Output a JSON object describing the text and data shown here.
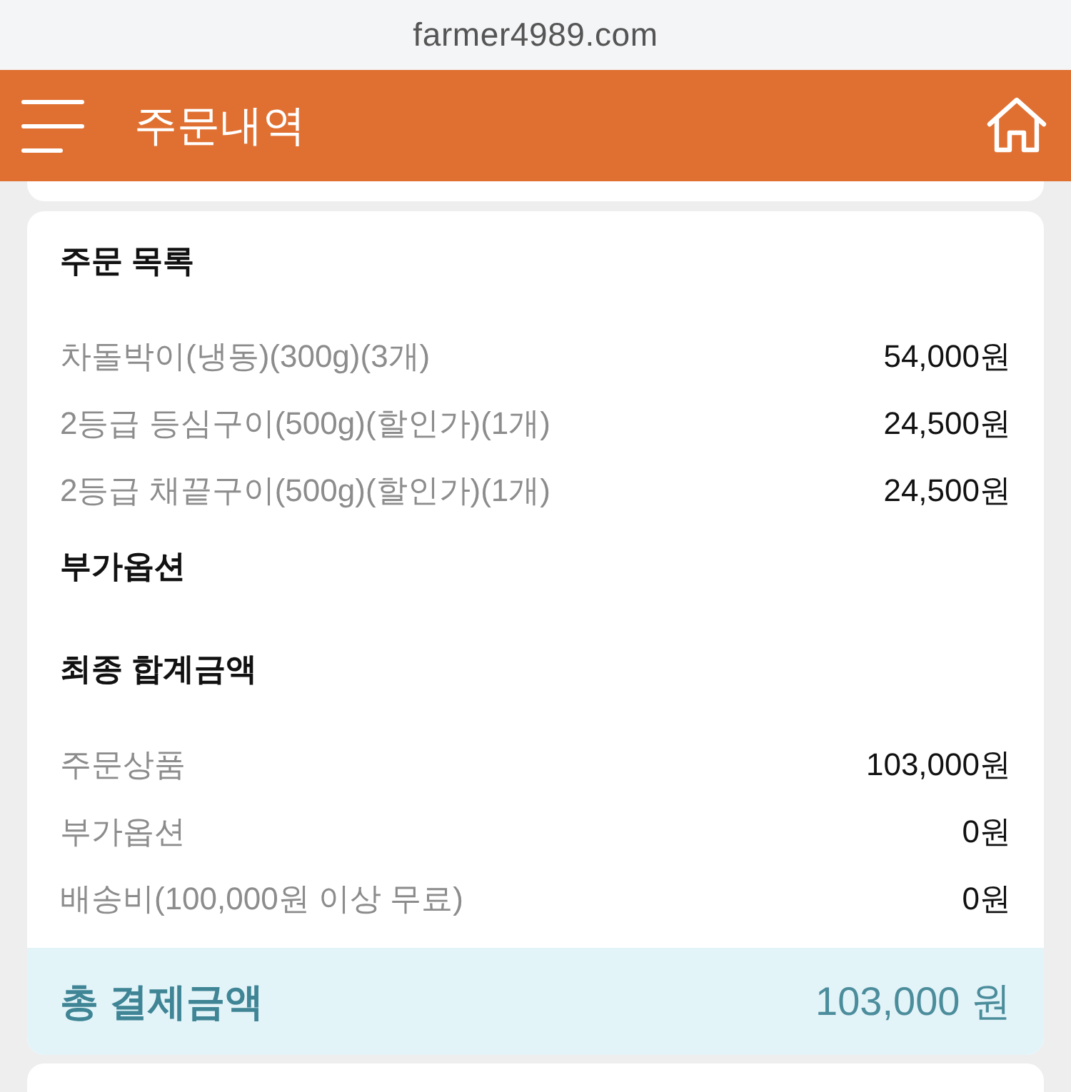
{
  "browser": {
    "url": "farmer4989.com"
  },
  "header": {
    "title": "주문내역"
  },
  "order_list": {
    "title": "주문 목록",
    "items": [
      {
        "name": "차돌박이(냉동)(300g)(3개)",
        "price": "54,000원"
      },
      {
        "name": "2등급 등심구이(500g)(할인가)(1개)",
        "price": "24,500원"
      },
      {
        "name": "2등급 채끝구이(500g)(할인가)(1개)",
        "price": "24,500원"
      }
    ]
  },
  "options": {
    "title": "부가옵션"
  },
  "summary": {
    "title": "최종 합계금액",
    "rows": [
      {
        "label": "주문상품",
        "value": "103,000원"
      },
      {
        "label": "부가옵션",
        "value": "0원"
      },
      {
        "label": "배송비(100,000원 이상 무료)",
        "value": "0원"
      }
    ]
  },
  "total": {
    "label": "총 결제금액",
    "value": "103,000 원"
  }
}
